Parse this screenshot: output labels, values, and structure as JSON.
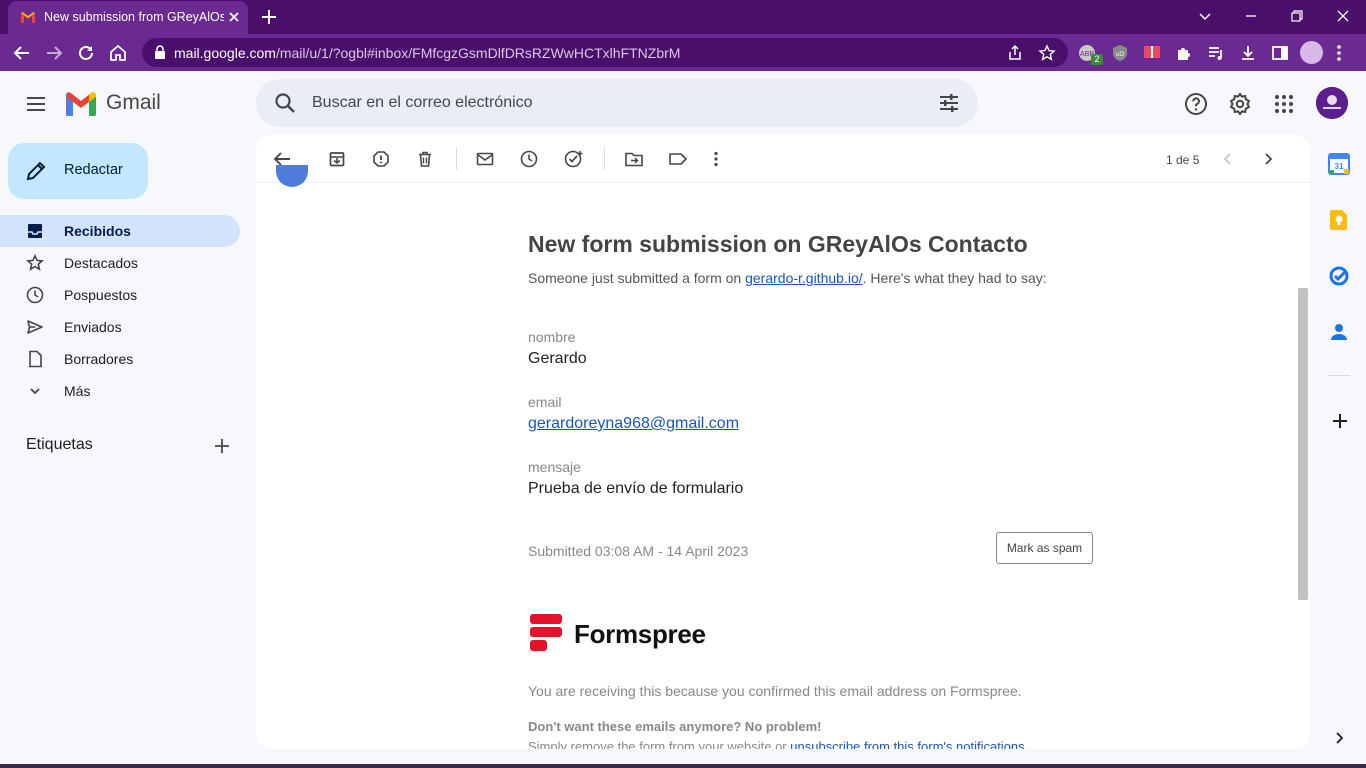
{
  "browser": {
    "tab_title": "New submission from GReyAlOs",
    "url_host": "mail.google.com",
    "url_path": "/mail/u/1/?ogbl#inbox/FMfcgzGsmDlfDRsRZWwHCTxlhFTNZbrM",
    "extension_badge": "2",
    "theme_color": "#6b2a91"
  },
  "gmail": {
    "wordmark": "Gmail",
    "search_placeholder": "Buscar en el correo electrónico",
    "compose_label": "Redactar",
    "nav": [
      {
        "label": "Recibidos",
        "icon": "inbox-icon",
        "active": true
      },
      {
        "label": "Destacados",
        "icon": "star-icon"
      },
      {
        "label": "Pospuestos",
        "icon": "clock-icon"
      },
      {
        "label": "Enviados",
        "icon": "send-icon"
      },
      {
        "label": "Borradores",
        "icon": "draft-icon"
      },
      {
        "label": "Más",
        "icon": "chevron-down-icon"
      }
    ],
    "labels_heading": "Etiquetas",
    "pager": "1 de 5"
  },
  "email": {
    "title": "New form submission on GReyAlOs Contacto",
    "intro_prefix": "Someone just submitted a form on ",
    "intro_link": "gerardo-r.github.io/",
    "intro_suffix": ". Here's what they had to say:",
    "fields": [
      {
        "label": "nombre",
        "value": "Gerardo"
      },
      {
        "label": "email",
        "value": "gerardoreyna968@gmail.com"
      },
      {
        "label": "mensaje",
        "value": "Prueba de envío de formulario"
      }
    ],
    "submitted": "Submitted 03:08 AM - 14 April 2023",
    "spam_button": "Mark as spam",
    "brand": "Formspree",
    "brand_color": "#e5122e",
    "confirm_note": "You are receiving this because you confirmed this email address on Formspree.",
    "unsub_heading": "Don't want these emails anymore? No problem!",
    "unsub_prefix": "Simply remove the form from your website or ",
    "unsub_link": "unsubscribe from this form's notifications"
  }
}
